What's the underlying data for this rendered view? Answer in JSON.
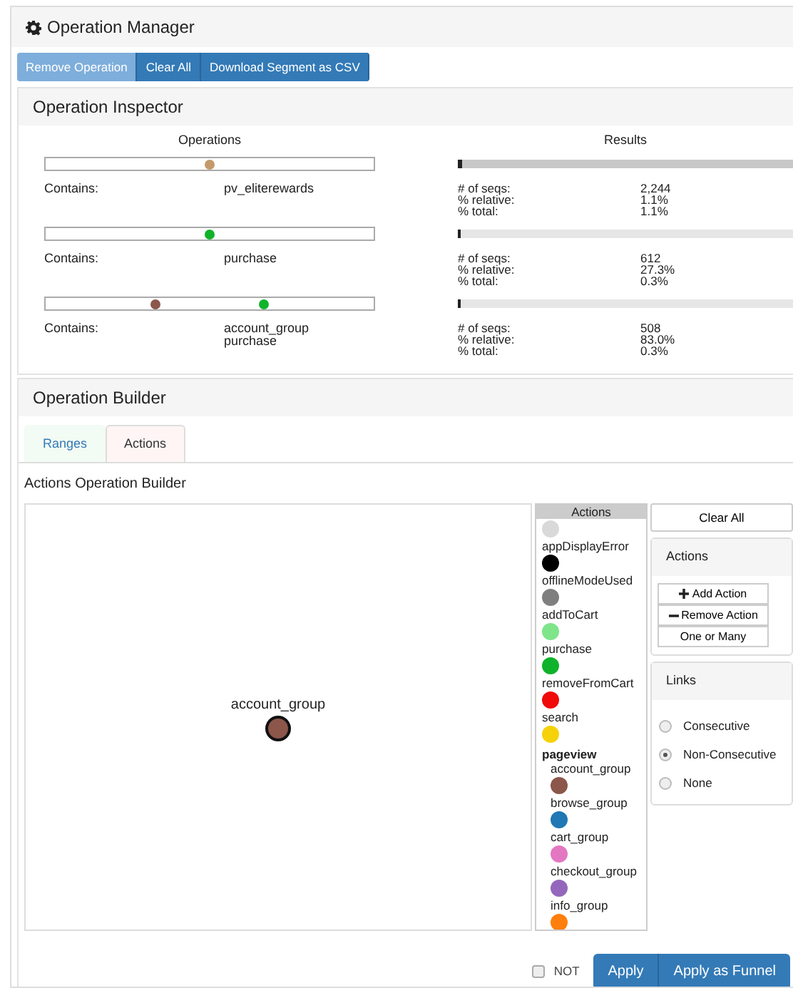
{
  "window": {
    "title": "Operation Manager"
  },
  "toolbar": [
    {
      "label": "Remove Operation",
      "disabled": true
    },
    {
      "label": "Clear All",
      "disabled": false
    },
    {
      "label": "Download Segment as CSV",
      "disabled": false
    }
  ],
  "inspector": {
    "title": "Operation Inspector",
    "operations_heading": "Operations",
    "results_heading": "Results",
    "operations": [
      {
        "selected": true,
        "label": "Contains:",
        "actions": [
          {
            "name": "pv_eliterewards",
            "color": "#c49a6c"
          }
        ],
        "result": {
          "level": 0.011,
          "stats": [
            {
              "label": "# of seqs:",
              "value": "2,244"
            },
            {
              "label": "% relative:",
              "value": "1.1%"
            },
            {
              "label": "% total:",
              "value": "1.1%"
            }
          ]
        }
      },
      {
        "selected": false,
        "label": "Contains:",
        "actions": [
          {
            "name": "purchase",
            "color": "#0fb32a"
          }
        ],
        "result": {
          "level": 0.003,
          "stats": [
            {
              "label": "# of seqs:",
              "value": "612"
            },
            {
              "label": "% relative:",
              "value": "27.3%"
            },
            {
              "label": "% total:",
              "value": "0.3%"
            }
          ]
        }
      },
      {
        "selected": false,
        "label": "Contains:",
        "actions": [
          {
            "name": "account_group",
            "color": "#8c564b"
          },
          {
            "name": "purchase",
            "color": "#0fb32a"
          }
        ],
        "result": {
          "level": 0.003,
          "stats": [
            {
              "label": "# of seqs:",
              "value": "508"
            },
            {
              "label": "% relative:",
              "value": "83.0%"
            },
            {
              "label": "% total:",
              "value": "0.3%"
            }
          ]
        }
      }
    ]
  },
  "builder": {
    "title": "Operation Builder",
    "tabs": [
      {
        "label": "Ranges",
        "selected": false
      },
      {
        "label": "Actions",
        "selected": true
      }
    ],
    "subtitle": "Actions Operation Builder",
    "canvas": {
      "nodes": [
        {
          "name": "account_group",
          "color": "#8c564b"
        }
      ]
    },
    "actions_list": {
      "heading": "Actions",
      "items": [
        {
          "kind": "action",
          "color": "#d9d9d9"
        },
        {
          "kind": "action",
          "name": "appDisplayError",
          "color": "#000000"
        },
        {
          "kind": "action",
          "name": "offlineModeUsed",
          "color": "#7f7f7f"
        },
        {
          "kind": "action",
          "name": "addToCart",
          "color": "#7ee58a"
        },
        {
          "kind": "action",
          "name": "purchase",
          "color": "#0fb32a"
        },
        {
          "kind": "action",
          "name": "removeFromCart",
          "color": "#f00a0a"
        },
        {
          "kind": "action",
          "name": "search",
          "color": "#f5d20a"
        },
        {
          "kind": "group",
          "name": "pageview",
          "children": [
            {
              "kind": "action",
              "name": "account_group",
              "color": "#8c564b"
            },
            {
              "kind": "action",
              "name": "browse_group",
              "color": "#1f77b4"
            },
            {
              "kind": "action",
              "name": "cart_group",
              "color": "#e377c2"
            },
            {
              "kind": "action",
              "name": "checkout_group",
              "color": "#9467bd"
            },
            {
              "kind": "action",
              "name": "info_group",
              "color": "#ff7f0e"
            }
          ]
        }
      ]
    },
    "clear_button": "Clear All",
    "actions_panel": {
      "title": "Actions",
      "buttons": [
        {
          "kind": "add",
          "label": "Add Action"
        },
        {
          "kind": "remove",
          "label": "Remove Action"
        },
        {
          "kind": "plain",
          "label": "One or Many"
        }
      ]
    },
    "links_panel": {
      "title": "Links",
      "options": [
        {
          "label": "Consecutive",
          "selected": false
        },
        {
          "label": "Non-Consecutive",
          "selected": true
        },
        {
          "label": "None",
          "selected": false
        }
      ]
    },
    "not_checkbox": {
      "label": "NOT",
      "checked": false
    },
    "apply_buttons": [
      "Apply",
      "Apply as Funnel"
    ]
  }
}
